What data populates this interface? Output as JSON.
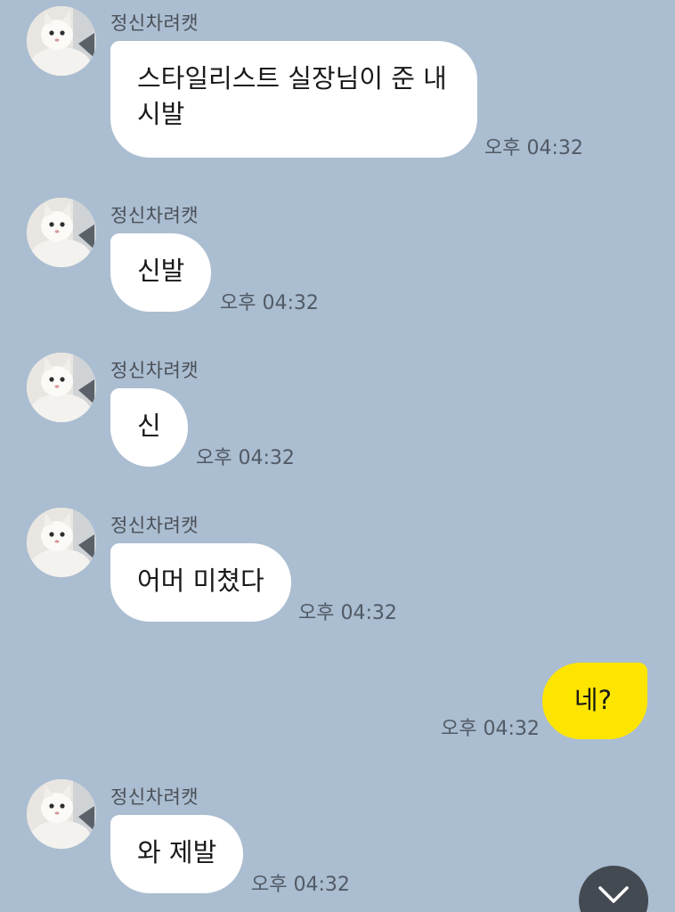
{
  "messages": [
    {
      "sender": "정신차려캣",
      "text": "스타일리스트 실장님이 준 내 시발",
      "time": "오후 04:32"
    },
    {
      "sender": "정신차려캣",
      "text": "신발",
      "time": "오후 04:32"
    },
    {
      "sender": "정신차려캣",
      "text": "신",
      "time": "오후 04:32"
    },
    {
      "sender": "정신차려캣",
      "text": "어머 미쳤다",
      "time": "오후 04:32"
    },
    {
      "text": "네?",
      "time": "오후 04:32"
    },
    {
      "sender": "정신차려캣",
      "text": "와 제발",
      "time": "오후 04:32"
    }
  ],
  "icons": {
    "avatar": "cat-avatar-icon",
    "scroll": "chevron-down-icon"
  },
  "colors": {
    "background": "#abbdd0",
    "incoming_bubble": "#ffffff",
    "outgoing_bubble": "#fee500",
    "scroll_button": "#444a52"
  }
}
